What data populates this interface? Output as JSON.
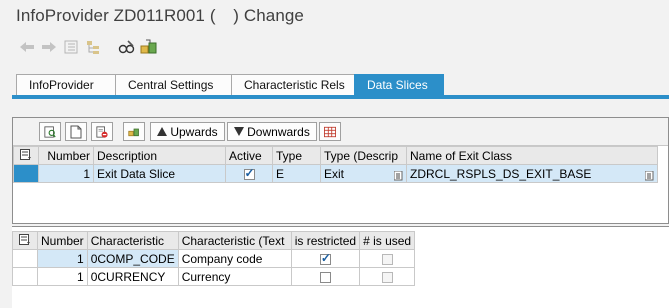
{
  "window": {
    "title_prefix": "InfoProvider ZD011R001",
    "title_paren": "(",
    "title_paren_close": ")",
    "title_suffix": "Change"
  },
  "toolbar": {
    "icons": [
      "back-arrow-icon",
      "forward-arrow-icon",
      "list-icon",
      "hierarchy-icon",
      "display-change-icon",
      "activate-icon"
    ]
  },
  "tabs": [
    {
      "label": "InfoProvider",
      "active": false
    },
    {
      "label": "Central Settings",
      "active": false
    },
    {
      "label": "Characteristic Rels",
      "active": false
    },
    {
      "label": "Data Slices",
      "active": true
    }
  ],
  "slices_toolbar": {
    "upwards_label": "Upwards",
    "downwards_label": "Downwards"
  },
  "slices_table": {
    "columns": [
      "Number",
      "Description",
      "Active",
      "Type",
      "Type (Descrip",
      "Name of Exit Class"
    ],
    "rows": [
      {
        "number": "1",
        "description": "Exit Data Slice",
        "active": true,
        "type": "E",
        "type_desc": "Exit",
        "exit_class": "ZDRCL_RSPLS_DS_EXIT_BASE"
      }
    ]
  },
  "char_table": {
    "columns": [
      "Number",
      "Characteristic",
      "Characteristic (Text",
      "is restricted",
      "# is used"
    ],
    "rows": [
      {
        "number": "1",
        "characteristic": "0COMP_CODE",
        "text": "Company code",
        "restricted": true,
        "used": false
      },
      {
        "number": "1",
        "characteristic": "0CURRENCY",
        "text": "Currency",
        "restricted": false,
        "used": false
      }
    ]
  },
  "colors": {
    "accent": "#2c8fc9",
    "selected_row": "#d4e8f7"
  }
}
